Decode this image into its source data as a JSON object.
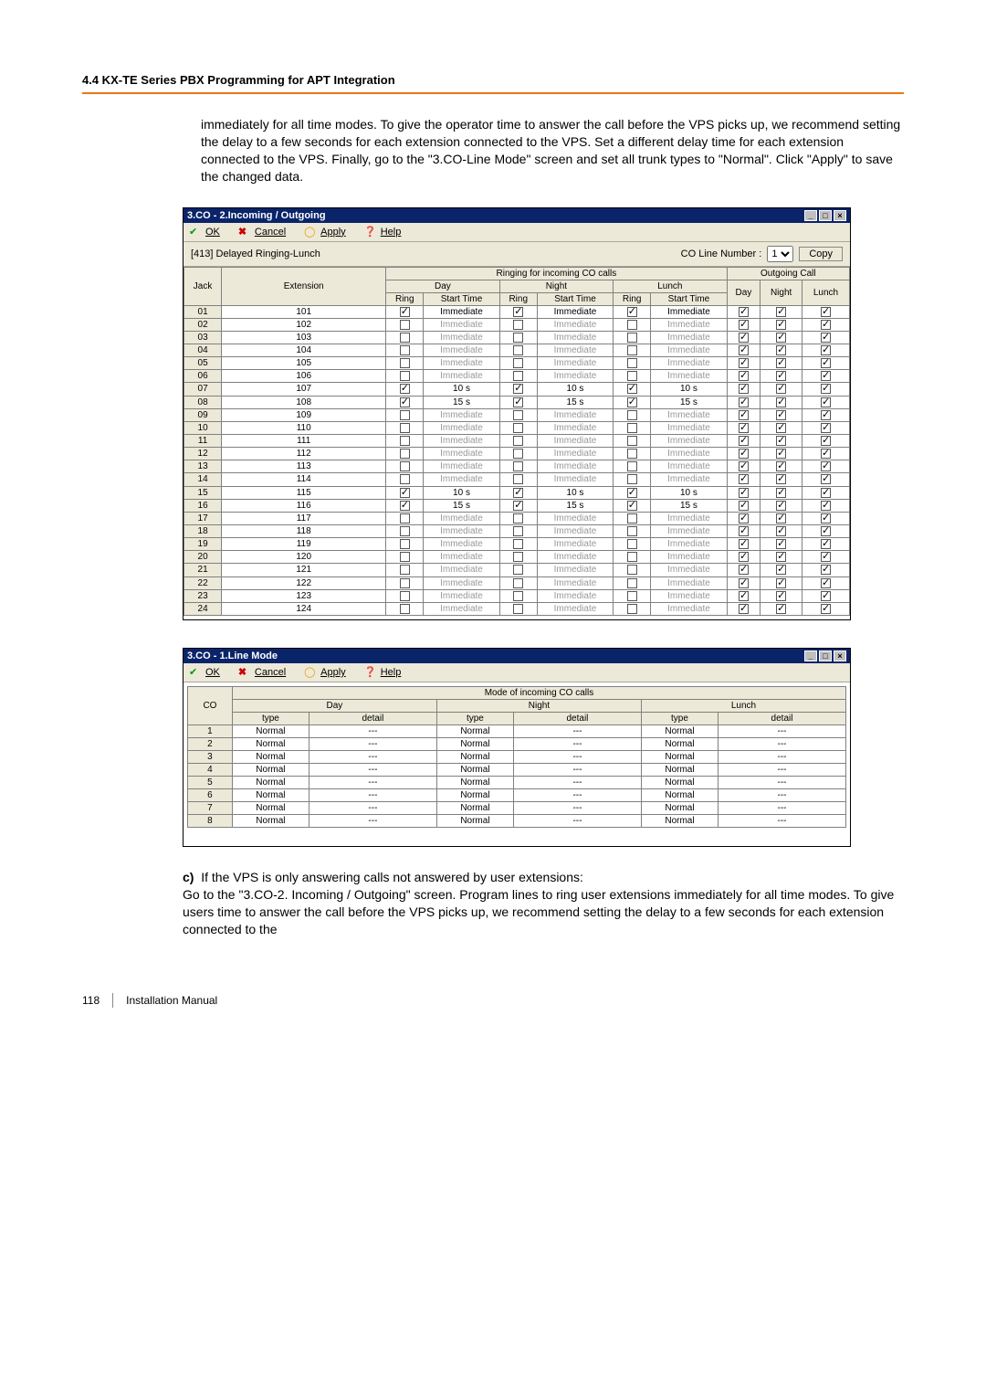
{
  "header": {
    "title": "4.4 KX-TE Series PBX Programming for APT Integration"
  },
  "para_top": "immediately for all time modes. To give the operator time to answer the call before the VPS picks up, we recommend setting the delay to a few seconds for each extension connected to the VPS. Set a different delay time for each extension connected to the VPS. Finally, go to the \"3.CO-Line Mode\" screen and set all trunk types to \"Normal\". Click \"Apply\" to save the changed data.",
  "win1": {
    "title": "3.CO - 2.Incoming / Outgoing",
    "buttons": {
      "ok": "OK",
      "cancel": "Cancel",
      "apply": "Apply",
      "help": "Help"
    },
    "subtitle": "[413] Delayed Ringing-Lunch",
    "co_label": "CO Line Number :",
    "co_value": "1",
    "copy": "Copy",
    "headers": {
      "ringing": "Ringing for incoming CO calls",
      "outgoing": "Outgoing Call",
      "jack": "Jack",
      "extension": "Extension",
      "day": "Day",
      "night": "Night",
      "lunch": "Lunch",
      "ring": "Ring",
      "start": "Start Time"
    },
    "rows": [
      {
        "jack": "01",
        "ext": "101",
        "d_r": true,
        "d_s": "Immediate",
        "n_r": true,
        "n_s": "Immediate",
        "l_r": true,
        "l_s": "Immediate",
        "od": true,
        "on": true,
        "ol": true,
        "dim": false
      },
      {
        "jack": "02",
        "ext": "102",
        "d_r": false,
        "d_s": "Immediate",
        "n_r": false,
        "n_s": "Immediate",
        "l_r": false,
        "l_s": "Immediate",
        "od": true,
        "on": true,
        "ol": true,
        "dim": true
      },
      {
        "jack": "03",
        "ext": "103",
        "d_r": false,
        "d_s": "Immediate",
        "n_r": false,
        "n_s": "Immediate",
        "l_r": false,
        "l_s": "Immediate",
        "od": true,
        "on": true,
        "ol": true,
        "dim": true
      },
      {
        "jack": "04",
        "ext": "104",
        "d_r": false,
        "d_s": "Immediate",
        "n_r": false,
        "n_s": "Immediate",
        "l_r": false,
        "l_s": "Immediate",
        "od": true,
        "on": true,
        "ol": true,
        "dim": true
      },
      {
        "jack": "05",
        "ext": "105",
        "d_r": false,
        "d_s": "Immediate",
        "n_r": false,
        "n_s": "Immediate",
        "l_r": false,
        "l_s": "Immediate",
        "od": true,
        "on": true,
        "ol": true,
        "dim": true
      },
      {
        "jack": "06",
        "ext": "106",
        "d_r": false,
        "d_s": "Immediate",
        "n_r": false,
        "n_s": "Immediate",
        "l_r": false,
        "l_s": "Immediate",
        "od": true,
        "on": true,
        "ol": true,
        "dim": true
      },
      {
        "jack": "07",
        "ext": "107",
        "d_r": true,
        "d_s": "10 s",
        "n_r": true,
        "n_s": "10 s",
        "l_r": true,
        "l_s": "10 s",
        "od": true,
        "on": true,
        "ol": true,
        "dim": false
      },
      {
        "jack": "08",
        "ext": "108",
        "d_r": true,
        "d_s": "15 s",
        "n_r": true,
        "n_s": "15 s",
        "l_r": true,
        "l_s": "15 s",
        "od": true,
        "on": true,
        "ol": true,
        "dim": false
      },
      {
        "jack": "09",
        "ext": "109",
        "d_r": false,
        "d_s": "Immediate",
        "n_r": false,
        "n_s": "Immediate",
        "l_r": false,
        "l_s": "Immediate",
        "od": true,
        "on": true,
        "ol": true,
        "dim": true
      },
      {
        "jack": "10",
        "ext": "110",
        "d_r": false,
        "d_s": "Immediate",
        "n_r": false,
        "n_s": "Immediate",
        "l_r": false,
        "l_s": "Immediate",
        "od": true,
        "on": true,
        "ol": true,
        "dim": true
      },
      {
        "jack": "11",
        "ext": "111",
        "d_r": false,
        "d_s": "Immediate",
        "n_r": false,
        "n_s": "Immediate",
        "l_r": false,
        "l_s": "Immediate",
        "od": true,
        "on": true,
        "ol": true,
        "dim": true
      },
      {
        "jack": "12",
        "ext": "112",
        "d_r": false,
        "d_s": "Immediate",
        "n_r": false,
        "n_s": "Immediate",
        "l_r": false,
        "l_s": "Immediate",
        "od": true,
        "on": true,
        "ol": true,
        "dim": true
      },
      {
        "jack": "13",
        "ext": "113",
        "d_r": false,
        "d_s": "Immediate",
        "n_r": false,
        "n_s": "Immediate",
        "l_r": false,
        "l_s": "Immediate",
        "od": true,
        "on": true,
        "ol": true,
        "dim": true
      },
      {
        "jack": "14",
        "ext": "114",
        "d_r": false,
        "d_s": "Immediate",
        "n_r": false,
        "n_s": "Immediate",
        "l_r": false,
        "l_s": "Immediate",
        "od": true,
        "on": true,
        "ol": true,
        "dim": true
      },
      {
        "jack": "15",
        "ext": "115",
        "d_r": true,
        "d_s": "10 s",
        "n_r": true,
        "n_s": "10 s",
        "l_r": true,
        "l_s": "10 s",
        "od": true,
        "on": true,
        "ol": true,
        "dim": false
      },
      {
        "jack": "16",
        "ext": "116",
        "d_r": true,
        "d_s": "15 s",
        "n_r": true,
        "n_s": "15 s",
        "l_r": true,
        "l_s": "15 s",
        "od": true,
        "on": true,
        "ol": true,
        "dim": false
      },
      {
        "jack": "17",
        "ext": "117",
        "d_r": false,
        "d_s": "Immediate",
        "n_r": false,
        "n_s": "Immediate",
        "l_r": false,
        "l_s": "Immediate",
        "od": true,
        "on": true,
        "ol": true,
        "dim": true
      },
      {
        "jack": "18",
        "ext": "118",
        "d_r": false,
        "d_s": "Immediate",
        "n_r": false,
        "n_s": "Immediate",
        "l_r": false,
        "l_s": "Immediate",
        "od": true,
        "on": true,
        "ol": true,
        "dim": true
      },
      {
        "jack": "19",
        "ext": "119",
        "d_r": false,
        "d_s": "Immediate",
        "n_r": false,
        "n_s": "Immediate",
        "l_r": false,
        "l_s": "Immediate",
        "od": true,
        "on": true,
        "ol": true,
        "dim": true
      },
      {
        "jack": "20",
        "ext": "120",
        "d_r": false,
        "d_s": "Immediate",
        "n_r": false,
        "n_s": "Immediate",
        "l_r": false,
        "l_s": "Immediate",
        "od": true,
        "on": true,
        "ol": true,
        "dim": true
      },
      {
        "jack": "21",
        "ext": "121",
        "d_r": false,
        "d_s": "Immediate",
        "n_r": false,
        "n_s": "Immediate",
        "l_r": false,
        "l_s": "Immediate",
        "od": true,
        "on": true,
        "ol": true,
        "dim": true
      },
      {
        "jack": "22",
        "ext": "122",
        "d_r": false,
        "d_s": "Immediate",
        "n_r": false,
        "n_s": "Immediate",
        "l_r": false,
        "l_s": "Immediate",
        "od": true,
        "on": true,
        "ol": true,
        "dim": true
      },
      {
        "jack": "23",
        "ext": "123",
        "d_r": false,
        "d_s": "Immediate",
        "n_r": false,
        "n_s": "Immediate",
        "l_r": false,
        "l_s": "Immediate",
        "od": true,
        "on": true,
        "ol": true,
        "dim": true
      },
      {
        "jack": "24",
        "ext": "124",
        "d_r": false,
        "d_s": "Immediate",
        "n_r": false,
        "n_s": "Immediate",
        "l_r": false,
        "l_s": "Immediate",
        "od": true,
        "on": true,
        "ol": true,
        "dim": true
      }
    ]
  },
  "win2": {
    "title": "3.CO - 1.Line Mode",
    "buttons": {
      "ok": "OK",
      "cancel": "Cancel",
      "apply": "Apply",
      "help": "Help"
    },
    "headers": {
      "mode": "Mode of incoming CO calls",
      "co": "CO",
      "day": "Day",
      "night": "Night",
      "lunch": "Lunch",
      "type": "type",
      "detail": "detail"
    },
    "rows": [
      {
        "co": "1",
        "d_t": "Normal",
        "d_d": "---",
        "n_t": "Normal",
        "n_d": "---",
        "l_t": "Normal",
        "l_d": "---"
      },
      {
        "co": "2",
        "d_t": "Normal",
        "d_d": "---",
        "n_t": "Normal",
        "n_d": "---",
        "l_t": "Normal",
        "l_d": "---"
      },
      {
        "co": "3",
        "d_t": "Normal",
        "d_d": "---",
        "n_t": "Normal",
        "n_d": "---",
        "l_t": "Normal",
        "l_d": "---"
      },
      {
        "co": "4",
        "d_t": "Normal",
        "d_d": "---",
        "n_t": "Normal",
        "n_d": "---",
        "l_t": "Normal",
        "l_d": "---"
      },
      {
        "co": "5",
        "d_t": "Normal",
        "d_d": "---",
        "n_t": "Normal",
        "n_d": "---",
        "l_t": "Normal",
        "l_d": "---"
      },
      {
        "co": "6",
        "d_t": "Normal",
        "d_d": "---",
        "n_t": "Normal",
        "n_d": "---",
        "l_t": "Normal",
        "l_d": "---"
      },
      {
        "co": "7",
        "d_t": "Normal",
        "d_d": "---",
        "n_t": "Normal",
        "n_d": "---",
        "l_t": "Normal",
        "l_d": "---"
      },
      {
        "co": "8",
        "d_t": "Normal",
        "d_d": "---",
        "n_t": "Normal",
        "n_d": "---",
        "l_t": "Normal",
        "l_d": "---"
      }
    ]
  },
  "note_c": {
    "label": "c)",
    "line1": "If the VPS is only answering calls not answered by user extensions:",
    "line2": "Go to the \"3.CO-2. Incoming / Outgoing\" screen. Program lines to ring user extensions immediately for all time modes. To give users time to answer the call before the VPS picks up, we recommend setting the delay to a few seconds for each extension connected to the"
  },
  "footer": {
    "page": "118",
    "doc": "Installation Manual"
  }
}
